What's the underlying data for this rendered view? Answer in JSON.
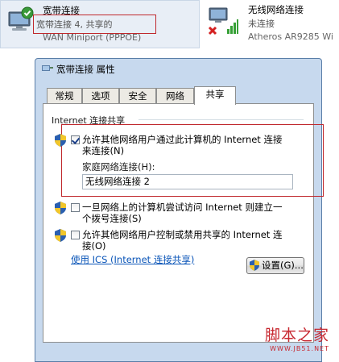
{
  "connections": [
    {
      "name": "宽带连接",
      "status": "宽带连接  4, 共享的",
      "device": "WAN Miniport (PPPOE)"
    },
    {
      "name": "无线网络连接",
      "status": "未连接",
      "device": "Atheros AR9285 Wi"
    }
  ],
  "dialog": {
    "title": "宽带连接 属性",
    "tabs": [
      "常规",
      "选项",
      "安全",
      "网络",
      "共享"
    ],
    "active_tab": "共享",
    "section_title": "Internet 连接共享",
    "options": [
      {
        "line1": "允许其他网络用户通过此计算机的 Internet 连接",
        "line2": "来连接(N)",
        "checked": true
      },
      {
        "line1": "一旦网络上的计算机尝试访问 Internet 则建立一",
        "line2": "个拨号连接(S)",
        "checked": false
      },
      {
        "line1": "允许其他网络用户控制或禁用共享的 Internet 连",
        "line2": "接(O)",
        "checked": false
      }
    ],
    "home_network_label": "家庭网络连接(H):",
    "home_network_value": "无线网络连接 2",
    "ics_link": "使用 ICS (Internet 连接共享)",
    "settings_button": "设置(G)..."
  },
  "watermark": {
    "main": "脚本之家",
    "sub": "WWW.JB51.NET"
  },
  "colors": {
    "highlight": "#c0282d",
    "link": "#0a55b8",
    "dialog_frame": "#c7d9ee"
  },
  "icons": [
    "checkmark-badge-icon",
    "network-computer-icon",
    "wifi-signal-icon",
    "disconnected-x-icon",
    "uac-shield-icon",
    "network-title-icon"
  ]
}
